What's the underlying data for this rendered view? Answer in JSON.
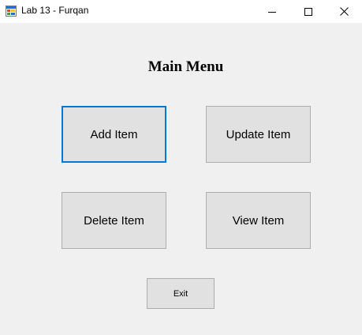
{
  "window": {
    "title": "Lab 13 - Furqan",
    "icon": "app-form-icon",
    "controls": {
      "minimize_icon": "minimize-icon",
      "maximize_icon": "maximize-icon",
      "close_icon": "close-icon"
    }
  },
  "main": {
    "heading": "Main Menu",
    "buttons": {
      "add": "Add Item",
      "update": "Update Item",
      "delete": "Delete Item",
      "view": "View Item",
      "exit": "Exit"
    },
    "focused_button": "add"
  },
  "colors": {
    "background": "#f0f0f0",
    "titlebar": "#ffffff",
    "button_face": "#e1e1e1",
    "button_border": "#adadad",
    "focus_border": "#0078d7"
  }
}
